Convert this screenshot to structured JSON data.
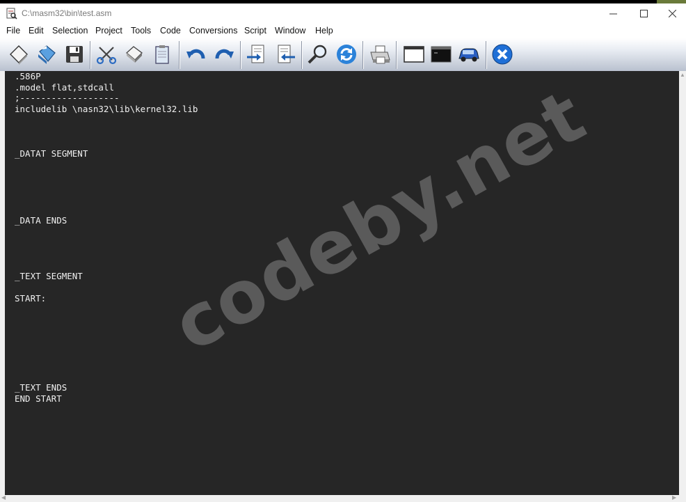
{
  "window": {
    "title": "C:\\masm32\\bin\\test.asm",
    "minimize_glyph": "—",
    "maximize_glyph": "☐",
    "close_glyph": "✕"
  },
  "menu": [
    "File",
    "Edit",
    "Selection",
    "Project",
    "Tools",
    "Code",
    "Conversions",
    "Script",
    "Window",
    "Help"
  ],
  "toolbar": {
    "icons": [
      "new-file-icon",
      "open-file-icon",
      "save-icon",
      "cut-icon",
      "copy-icon",
      "paste-icon",
      "undo-icon",
      "redo-icon",
      "import-icon",
      "export-icon",
      "find-icon",
      "refresh-icon",
      "print-icon",
      "window-icon",
      "console-icon",
      "run-icon",
      "exit-icon"
    ]
  },
  "editor": {
    "lines": [
      ".586P",
      ".model flat,stdcall",
      ";-------------------",
      "includelib \\nasn32\\lib\\kernel32.lib",
      "_DATAT SEGMENT",
      "_DATA ENDS",
      "_TEXT SEGMENT",
      "START:",
      "_TEXT ENDS",
      "END START"
    ],
    "watermark": "codeby.net"
  },
  "colors": {
    "editor_bg": "#262626",
    "editor_text": "#f1f1f1",
    "watermark": "#5d5d5d",
    "toolbar_gradient_end": "#b9c1cf"
  }
}
